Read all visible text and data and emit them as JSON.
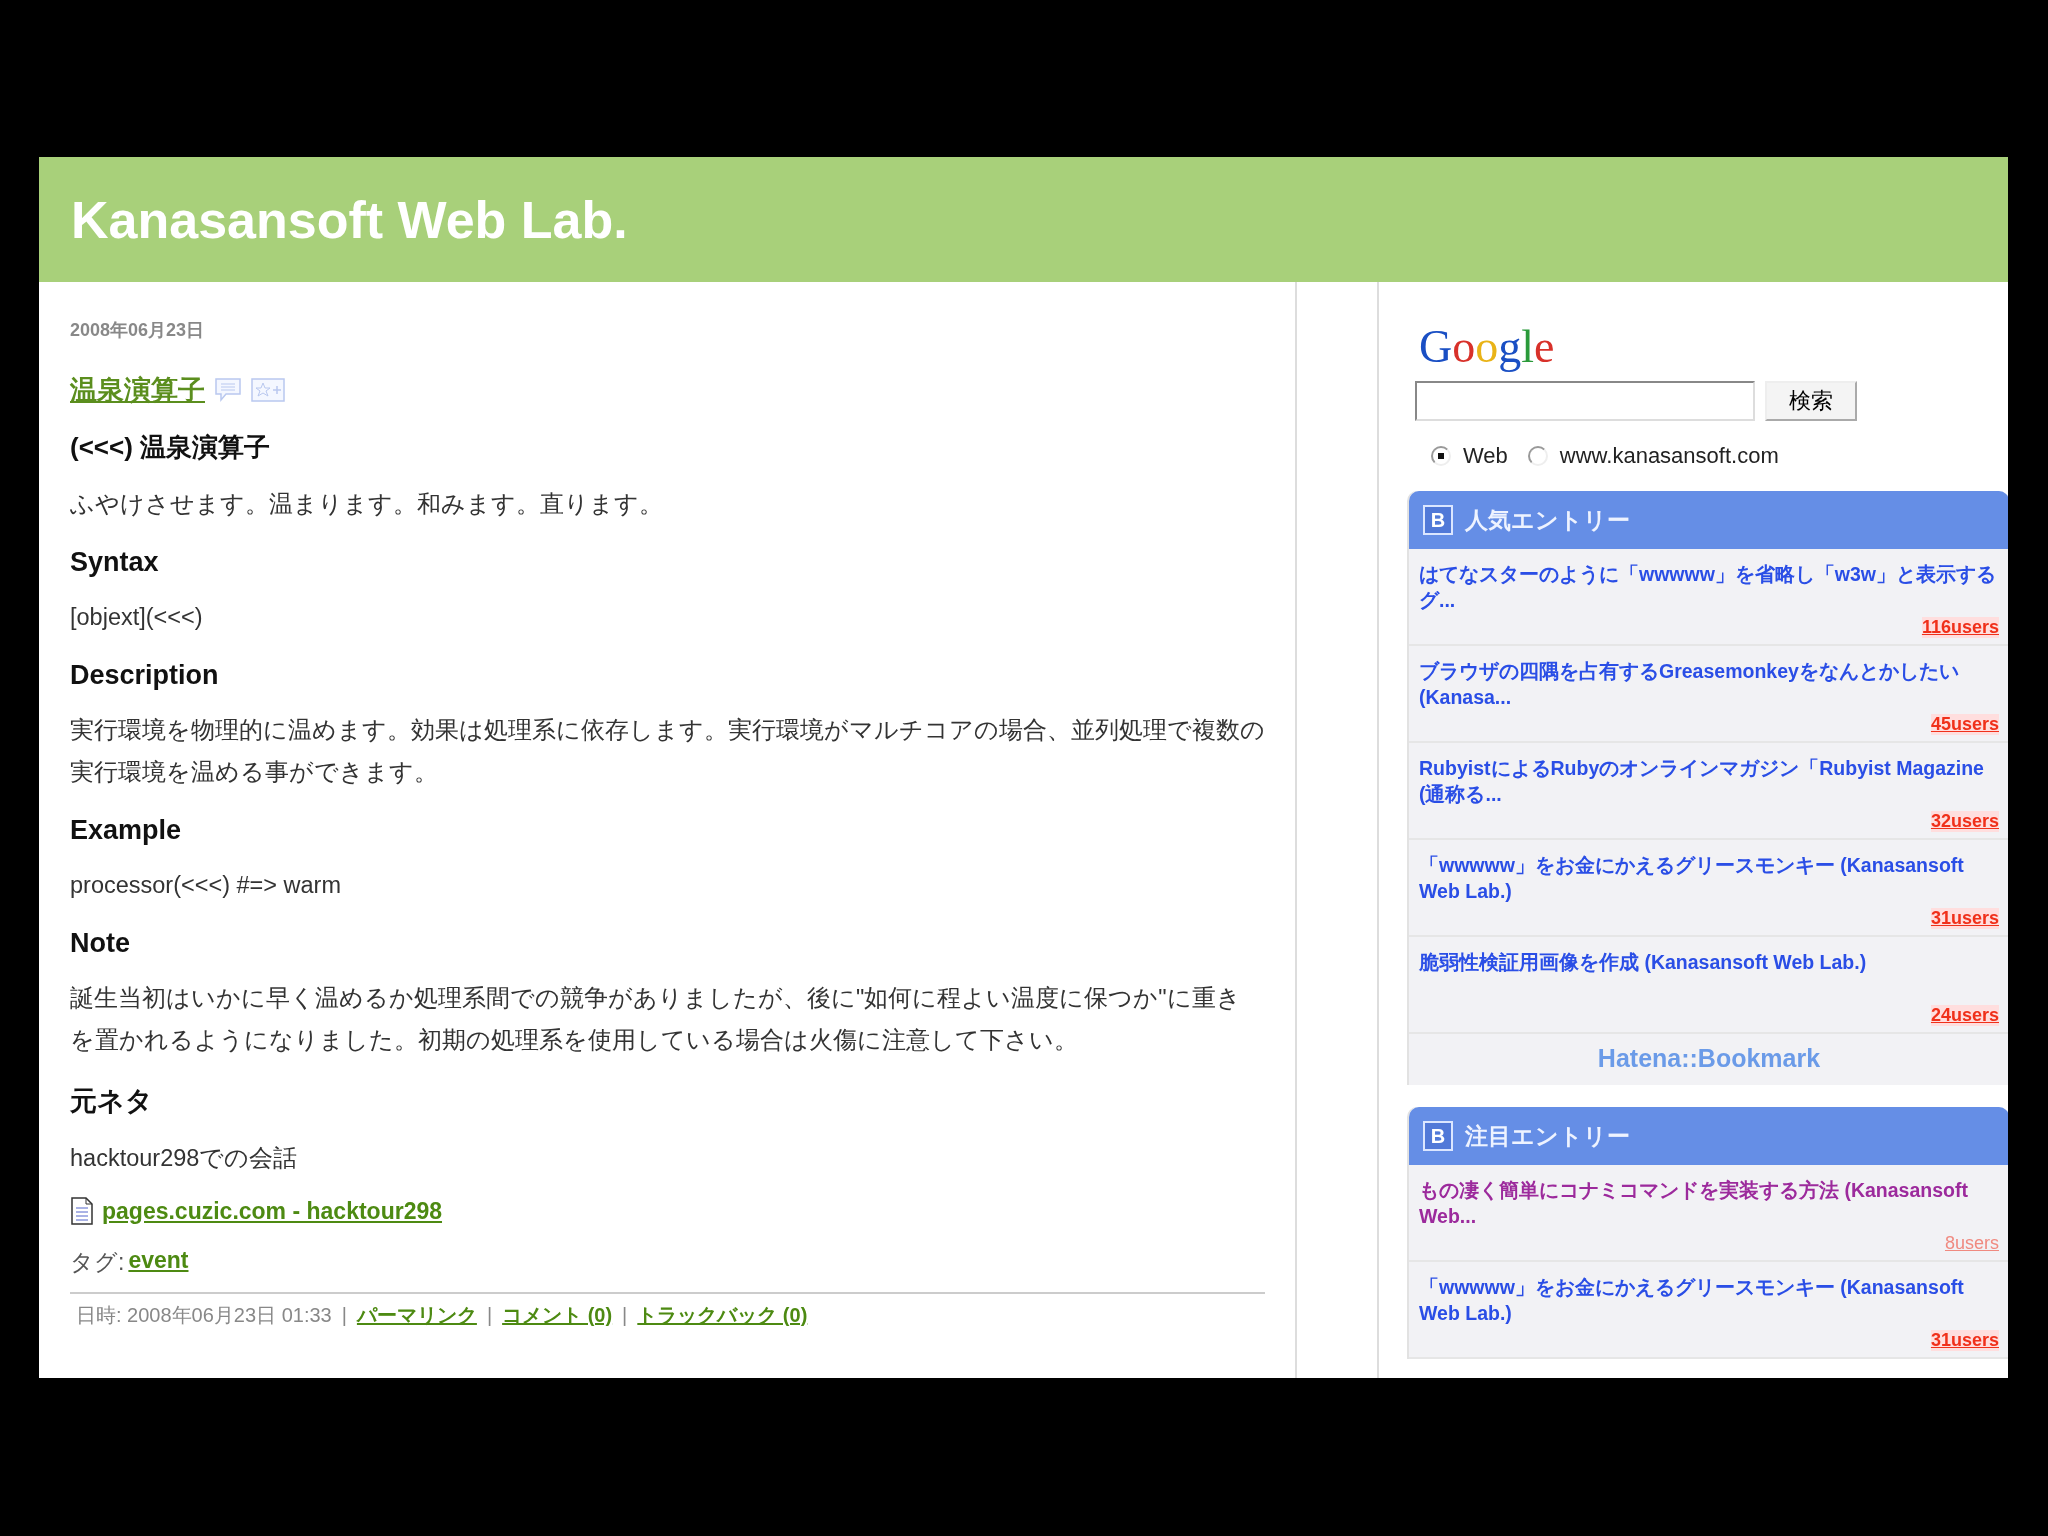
{
  "site_title": "Kanasansoft Web Lab.",
  "post": {
    "date": "2008年06月23日",
    "title": "温泉演算子",
    "heading": "(<<<) 温泉演算子",
    "lead": "ふやけさせます。温まります。和みます。直ります。",
    "sections": [
      {
        "heading": "Syntax",
        "body": "[objext](<<<)"
      },
      {
        "heading": "Description",
        "body": "実行環境を物理的に温めます。効果は処理系に依存します。実行環境がマルチコアの場合、並列処理で複数の実行環境を温める事ができます。"
      },
      {
        "heading": "Example",
        "body": "processor(<<<) #=> warm"
      },
      {
        "heading": "Note",
        "body": "誕生当初はいかに早く温めるか処理系間での競争がありましたが、後に\"如何に程よい温度に保つか\"に重きを置かれるようになりました。初期の処理系を使用している場合は火傷に注意して下さい。"
      },
      {
        "heading": "元ネタ",
        "body": "hacktour298での会話"
      }
    ],
    "source_link": "pages.cuzic.com - hacktour298",
    "tag_label": "タグ:",
    "tag": "event",
    "footer": {
      "separator": "|",
      "datetime": "日時: 2008年06月23日 01:33",
      "links": [
        "パーマリンク",
        "コメント (0)",
        "トラックバック (0)"
      ]
    }
  },
  "sidebar": {
    "google_logo": "Google",
    "search": {
      "button": "検索"
    },
    "scopes": [
      {
        "label": "Web",
        "selected": true
      },
      {
        "label": "www.kanasansoft.com",
        "selected": false
      }
    ],
    "widgets": [
      {
        "badge": "B",
        "title": "人気エントリー",
        "footer": "Hatena::Bookmark",
        "entries": [
          {
            "title": "はてなスターのように「wwwww」を省略し「w3w」と表示するグ...",
            "users": "116users",
            "visited": false,
            "faint": false
          },
          {
            "title": "ブラウザの四隅を占有するGreasemonkeyをなんとかしたい (Kanasa...",
            "users": "45users",
            "visited": false,
            "faint": false
          },
          {
            "title": "RubyistによるRubyのオンラインマガジン「Rubyist Magazine (通称る...",
            "users": "32users",
            "visited": false,
            "faint": false
          },
          {
            "title": "「wwwww」をお金にかえるグリースモンキー (Kanasansoft Web Lab.)",
            "users": "31users",
            "visited": false,
            "faint": false
          },
          {
            "title": "脆弱性検証用画像を作成 (Kanasansoft Web Lab.)",
            "users": "24users",
            "visited": false,
            "faint": false
          }
        ]
      },
      {
        "badge": "B",
        "title": "注目エントリー",
        "entries": [
          {
            "title": "もの凄く簡単にコナミコマンドを実装する方法 (Kanasansoft Web...",
            "users": "8users",
            "visited": true,
            "faint": true
          },
          {
            "title": "「wwwww」をお金にかえるグリースモンキー (Kanasansoft Web Lab.)",
            "users": "31users",
            "visited": false,
            "faint": false
          }
        ]
      }
    ]
  }
}
